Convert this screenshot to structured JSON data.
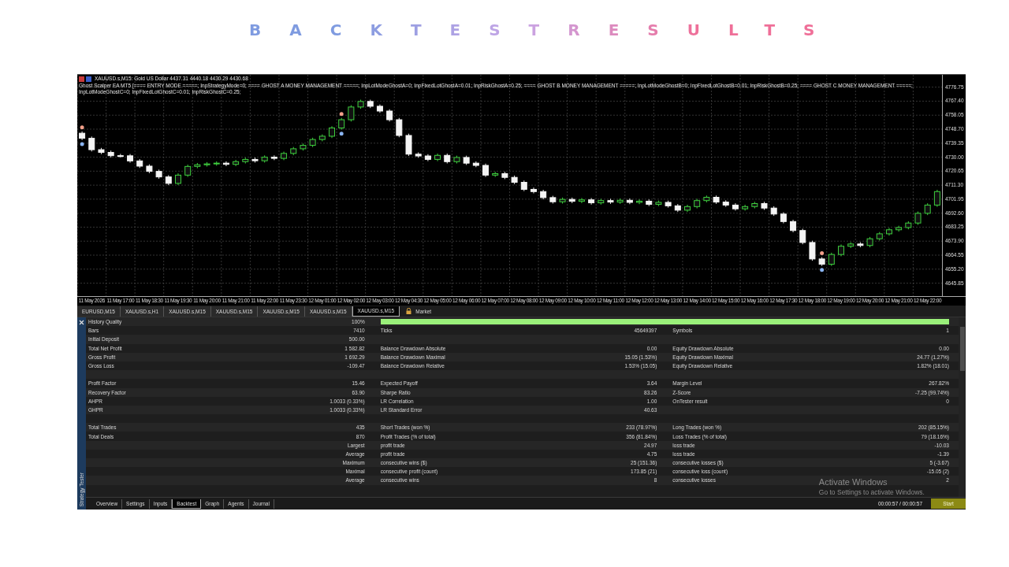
{
  "title": "BACKTESTRESULTS",
  "chart": {
    "symbol_line": "XAUUSD.s,M15:  Gold US Dollar  4437.31 4440.18 4430.29 4430.68",
    "ea_line": "Ghost Scalper EA MT5 [==== ENTRY MODE =====; InpStrategyMode=0; ==== GHOST A MONEY MANAGEMENT =====; InpLotModeGhostA=0; InpFixedLotGhostA=0.01; InpRiskGhostA=0.25; ==== GHOST B MONEY MANAGEMENT =====; InpLotModeGhostB=0; InpFixedLotGhostB=0.01; InpRiskGhostB=0.25; ==== GHOST C MONEY MANAGEMENT =====; InpLotModeGhostC=0; InpFixedLotGhostC=0.01; InpRiskGhostC=0.25;",
    "chart_data": {
      "type": "candlestick",
      "categories": [
        null,
        "11 May 2026",
        null,
        null,
        "11 May 17:00",
        null,
        null,
        "11 May 18:30",
        null,
        null,
        "11 May 19:30",
        null,
        null,
        "11 May 20:00",
        null,
        null,
        "11 May 21:00",
        null,
        null,
        "11 May 22:00",
        null,
        null,
        "11 May 23:30",
        null,
        null,
        "12 May 01:00",
        null,
        null,
        "12 May 02:00",
        null,
        null,
        "12 May 03:00",
        null,
        null,
        "12 May 04:30",
        null,
        null,
        "12 May 05:00",
        null,
        null,
        "12 May 06:00",
        null,
        null,
        "12 May 07:00",
        null,
        null,
        "12 May 08:00",
        null,
        null,
        "12 May 09:00",
        null,
        null,
        "12 May 10:00",
        null,
        null,
        "12 May 11:00",
        null,
        null,
        "12 May 12:00",
        null,
        null,
        "12 May 13:00",
        null,
        null,
        "12 May 14:00",
        null,
        null,
        "12 May 15:00",
        null,
        null,
        "12 May 16:00",
        null,
        null,
        "12 May 17:30",
        null,
        null,
        "12 May 18:00",
        null,
        null,
        "12 May 19:00",
        null,
        null,
        "12 May 20:00",
        null,
        null,
        "12 May 21:00",
        null,
        null,
        "12 May 22:00",
        null
      ],
      "grid": true,
      "ohlc": [
        [
          4746.0,
          4747.2,
          4741.4,
          4742.6
        ],
        [
          4742.6,
          4743.8,
          4733.8,
          4735.0
        ],
        [
          4735.0,
          4736.2,
          4732.0,
          4733.2
        ],
        [
          4733.2,
          4734.4,
          4729.8,
          4731.0
        ],
        [
          4731.0,
          4732.2,
          4729.7,
          4730.9
        ],
        [
          4730.9,
          4732.1,
          4726.3,
          4727.5
        ],
        [
          4727.5,
          4728.7,
          4722.8,
          4724.0
        ],
        [
          4724.0,
          4725.2,
          4719.3,
          4720.5
        ],
        [
          4720.5,
          4721.7,
          4715.6,
          4716.8
        ],
        [
          4716.8,
          4718.0,
          4711.3,
          4712.5
        ],
        [
          4712.5,
          4719.2,
          4711.3,
          4718.0
        ],
        [
          4718.0,
          4725.0,
          4716.8,
          4723.8
        ],
        [
          4723.8,
          4726.1,
          4722.6,
          4724.9
        ],
        [
          4724.9,
          4726.7,
          4723.7,
          4725.5
        ],
        [
          4725.5,
          4727.2,
          4724.3,
          4726.0
        ],
        [
          4726.0,
          4727.2,
          4724.0,
          4725.2
        ],
        [
          4725.2,
          4728.2,
          4724.0,
          4727.0
        ],
        [
          4727.0,
          4729.7,
          4725.8,
          4728.5
        ],
        [
          4728.5,
          4729.7,
          4726.4,
          4727.6
        ],
        [
          4727.6,
          4731.2,
          4726.4,
          4730.0
        ],
        [
          4730.0,
          4731.2,
          4728.0,
          4729.2
        ],
        [
          4729.2,
          4733.7,
          4728.0,
          4732.5
        ],
        [
          4732.5,
          4736.8,
          4731.3,
          4735.6
        ],
        [
          4735.6,
          4739.1,
          4734.4,
          4737.9
        ],
        [
          4737.9,
          4743.0,
          4736.7,
          4741.8
        ],
        [
          4741.8,
          4745.2,
          4740.6,
          4744.0
        ],
        [
          4744.0,
          4750.7,
          4742.8,
          4749.5
        ],
        [
          4749.5,
          4756.2,
          4748.3,
          4755.0
        ],
        [
          4755.0,
          4764.7,
          4753.8,
          4763.5
        ],
        [
          4763.5,
          4768.4,
          4762.3,
          4767.2
        ],
        [
          4767.2,
          4768.4,
          4762.8,
          4764.0
        ],
        [
          4764.0,
          4765.2,
          4759.6,
          4760.8
        ],
        [
          4760.8,
          4762.0,
          4753.8,
          4755.0
        ],
        [
          4755.0,
          4756.2,
          4743.3,
          4744.5
        ],
        [
          4744.5,
          4745.7,
          4730.8,
          4732.0
        ],
        [
          4732.0,
          4733.2,
          4729.6,
          4730.8
        ],
        [
          4730.8,
          4732.0,
          4727.3,
          4728.5
        ],
        [
          4728.5,
          4732.4,
          4727.3,
          4731.2
        ],
        [
          4731.2,
          4732.4,
          4725.8,
          4727.0
        ],
        [
          4727.0,
          4731.0,
          4725.8,
          4729.8
        ],
        [
          4729.8,
          4731.0,
          4724.8,
          4726.0
        ],
        [
          4726.0,
          4727.2,
          4723.3,
          4724.5
        ],
        [
          4724.5,
          4725.7,
          4716.8,
          4718.0
        ],
        [
          4718.0,
          4720.2,
          4716.8,
          4719.0
        ],
        [
          4719.0,
          4720.2,
          4715.3,
          4716.5
        ],
        [
          4716.5,
          4717.7,
          4712.0,
          4713.2
        ],
        [
          4713.2,
          4714.4,
          4707.3,
          4708.5
        ],
        [
          4708.5,
          4709.7,
          4705.8,
          4707.0
        ],
        [
          4707.0,
          4708.2,
          4701.8,
          4703.0
        ],
        [
          4703.0,
          4704.2,
          4699.0,
          4700.2
        ],
        [
          4700.2,
          4703.0,
          4699.0,
          4701.8
        ],
        [
          4701.8,
          4703.0,
          4699.3,
          4700.5
        ],
        [
          4700.5,
          4702.7,
          4699.3,
          4701.5
        ],
        [
          4701.5,
          4702.7,
          4698.3,
          4699.5
        ],
        [
          4699.5,
          4702.2,
          4698.3,
          4701.0
        ],
        [
          4701.0,
          4702.2,
          4698.8,
          4700.0
        ],
        [
          4700.0,
          4702.4,
          4698.8,
          4701.2
        ],
        [
          4701.2,
          4702.4,
          4698.6,
          4699.8
        ],
        [
          4699.8,
          4701.8,
          4698.6,
          4700.6
        ],
        [
          4700.6,
          4701.8,
          4697.3,
          4698.5
        ],
        [
          4698.5,
          4701.0,
          4697.3,
          4699.8
        ],
        [
          4699.8,
          4701.0,
          4696.3,
          4697.5
        ],
        [
          4697.5,
          4698.7,
          4693.4,
          4694.6
        ],
        [
          4694.6,
          4698.2,
          4693.4,
          4697.0
        ],
        [
          4697.0,
          4702.2,
          4695.8,
          4701.0
        ],
        [
          4701.0,
          4704.4,
          4699.8,
          4703.2
        ],
        [
          4703.2,
          4704.4,
          4698.8,
          4700.0
        ],
        [
          4700.0,
          4701.2,
          4696.8,
          4698.0
        ],
        [
          4698.0,
          4699.2,
          4694.3,
          4695.5
        ],
        [
          4695.5,
          4698.2,
          4694.3,
          4697.0
        ],
        [
          4697.0,
          4700.2,
          4695.8,
          4699.0
        ],
        [
          4699.0,
          4700.2,
          4694.8,
          4696.0
        ],
        [
          4696.0,
          4697.2,
          4690.8,
          4692.0
        ],
        [
          4692.0,
          4693.2,
          4685.8,
          4687.0
        ],
        [
          4687.0,
          4688.2,
          4679.8,
          4681.0
        ],
        [
          4681.0,
          4682.2,
          4671.8,
          4673.0
        ],
        [
          4673.0,
          4674.2,
          4660.8,
          4662.0
        ],
        [
          4662.0,
          4663.2,
          4657.3,
          4658.5
        ],
        [
          4658.5,
          4666.2,
          4657.3,
          4665.0
        ],
        [
          4665.0,
          4671.7,
          4663.8,
          4670.5
        ],
        [
          4670.5,
          4673.2,
          4669.3,
          4672.0
        ],
        [
          4672.0,
          4673.2,
          4669.8,
          4671.0
        ],
        [
          4671.0,
          4676.7,
          4669.8,
          4675.5
        ],
        [
          4675.5,
          4680.0,
          4674.3,
          4678.8
        ],
        [
          4678.8,
          4682.7,
          4677.6,
          4681.5
        ],
        [
          4681.5,
          4684.2,
          4680.3,
          4683.0
        ],
        [
          4683.0,
          4687.2,
          4681.8,
          4686.0
        ],
        [
          4686.0,
          4693.7,
          4684.8,
          4692.5
        ],
        [
          4692.5,
          4699.2,
          4691.3,
          4698.0
        ],
        [
          4698.0,
          4708.2,
          4696.8,
          4707.0
        ]
      ],
      "ylim": [
        4637.2,
        4785
      ],
      "yticks": [
        {
          "value": 4776.75,
          "label": "4776.75"
        },
        {
          "value": 4767.4,
          "label": "4767.40"
        },
        {
          "value": 4758.05,
          "label": "4758.05"
        },
        {
          "value": 4748.7,
          "label": "4748.70"
        },
        {
          "value": 4739.35,
          "label": "4739.35"
        },
        {
          "value": 4730,
          "label": "4730.00"
        },
        {
          "value": 4720.65,
          "label": "4720.65"
        },
        {
          "value": 4711.3,
          "label": "4711.30"
        },
        {
          "value": 4701.95,
          "label": "4701.95"
        },
        {
          "value": 4692.6,
          "label": "4692.60"
        },
        {
          "value": 4683.25,
          "label": "4683.25"
        },
        {
          "value": 4673.9,
          "label": "4673.90"
        },
        {
          "value": 4664.55,
          "label": "4664.55"
        },
        {
          "value": 4655.2,
          "label": "4655.20"
        },
        {
          "value": 4645.85,
          "label": "4645.85"
        }
      ]
    }
  },
  "symbol_tabs": [
    {
      "label": "EURUSD,M15",
      "selected": false
    },
    {
      "label": "XAUUSD.s,H1",
      "selected": false
    },
    {
      "label": "XAUUSD.s,M15",
      "selected": false
    },
    {
      "label": "XAUUSD.s,M15",
      "selected": false
    },
    {
      "label": "XAUUSD.s,M15",
      "selected": false
    },
    {
      "label": "XAUUSD.s,M15",
      "selected": false
    },
    {
      "label": "XAUUSD.s,M15",
      "selected": true
    }
  ],
  "market_tab": "Market",
  "tester": {
    "side_label": "Strategy Tester",
    "rows": [
      {
        "kind": "quality",
        "groups": [
          {
            "label": "History Quality",
            "value": "100%"
          }
        ],
        "level": 1
      },
      {
        "kind": "stats",
        "groups": [
          {
            "label": "Bars",
            "value": "7410"
          },
          {
            "label": "Ticks",
            "value": "45649397"
          },
          {
            "label": "Symbols",
            "value": "1"
          }
        ]
      },
      {
        "kind": "stats",
        "groups": [
          {
            "label": "Initial Deposit",
            "value": "500.00"
          }
        ]
      },
      {
        "kind": "stats",
        "groups": [
          {
            "label": "Total Net Profit",
            "value": "1 582.82"
          },
          {
            "label": "Balance Drawdown Absolute",
            "value": "0.00"
          },
          {
            "label": "Equity Drawdown Absolute",
            "value": "0.00"
          }
        ]
      },
      {
        "kind": "stats",
        "groups": [
          {
            "label": "Gross Profit",
            "value": "1 692.29"
          },
          {
            "label": "Balance Drawdown Maximal",
            "value": "15.05 (1.53%)"
          },
          {
            "label": "Equity Drawdown Maximal",
            "value": "24.77 (1.27%)"
          }
        ]
      },
      {
        "kind": "stats",
        "groups": [
          {
            "label": "Gross Loss",
            "value": "-109.47"
          },
          {
            "label": "Balance Drawdown Relative",
            "value": "1.53% (15.05)"
          },
          {
            "label": "Equity Drawdown Relative",
            "value": "1.82% (18.01)"
          }
        ]
      },
      {
        "kind": "blank"
      },
      {
        "kind": "stats",
        "groups": [
          {
            "label": "Profit Factor",
            "value": "15.46"
          },
          {
            "label": "Expected Payoff",
            "value": "3.64"
          },
          {
            "label": "Margin Level",
            "value": "267.82%"
          }
        ]
      },
      {
        "kind": "stats",
        "groups": [
          {
            "label": "Recovery Factor",
            "value": "63.90"
          },
          {
            "label": "Sharpe Ratio",
            "value": "83.26"
          },
          {
            "label": "Z-Score",
            "value": "-7.25 (99.74%)"
          }
        ]
      },
      {
        "kind": "stats",
        "groups": [
          {
            "label": "AHPR",
            "value": "1.0033 (0.33%)"
          },
          {
            "label": "LR Correlation",
            "value": "1.00"
          },
          {
            "label": "OnTester result",
            "value": "0"
          }
        ]
      },
      {
        "kind": "stats",
        "groups": [
          {
            "label": "GHPR",
            "value": "1.0033 (0.33%)"
          },
          {
            "label": "LR Standard Error",
            "value": "40.63"
          }
        ]
      },
      {
        "kind": "blank"
      },
      {
        "kind": "stats",
        "groups": [
          {
            "label": "Total Trades",
            "value": "435"
          },
          {
            "label": "Short Trades (won %)",
            "value": "233 (78.97%)"
          },
          {
            "label": "Long Trades (won %)",
            "value": "202 (85.15%)"
          }
        ]
      },
      {
        "kind": "stats",
        "groups": [
          {
            "label": "Total Deals",
            "value": "870"
          },
          {
            "label": "Profit Trades (% of total)",
            "value": "356 (81.84%)"
          },
          {
            "label": "Loss Trades (% of total)",
            "value": "79 (18.16%)"
          }
        ]
      },
      {
        "kind": "stats",
        "groups": [
          {
            "value": "Largest"
          },
          {
            "label": "profit trade",
            "value": "24.97"
          },
          {
            "label": "loss trade",
            "value": "-10.03"
          }
        ]
      },
      {
        "kind": "stats",
        "groups": [
          {
            "value": "Average"
          },
          {
            "label": "profit trade",
            "value": "4.75"
          },
          {
            "label": "loss trade",
            "value": "-1.39"
          }
        ]
      },
      {
        "kind": "stats",
        "groups": [
          {
            "value": "Maximum"
          },
          {
            "label": "consecutive wins ($)",
            "value": "25 (151.36)"
          },
          {
            "label": "consecutive losses ($)",
            "value": "5 (-3.67)"
          }
        ]
      },
      {
        "kind": "stats",
        "groups": [
          {
            "value": "Maximal"
          },
          {
            "label": "consecutive profit (count)",
            "value": "173.85 (21)"
          },
          {
            "label": "consecutive loss (count)",
            "value": "-15.05 (2)"
          }
        ]
      },
      {
        "kind": "stats",
        "groups": [
          {
            "value": "Average"
          },
          {
            "label": "consecutive wins",
            "value": "8"
          },
          {
            "label": "consecutive losses",
            "value": "2"
          }
        ]
      },
      {
        "kind": "blank"
      }
    ],
    "tabs": [
      {
        "label": "Overview",
        "selected": false
      },
      {
        "label": "Settings",
        "selected": false
      },
      {
        "label": "Inputs",
        "selected": false
      },
      {
        "label": "Backtest",
        "selected": true
      },
      {
        "label": "Graph",
        "selected": false
      },
      {
        "label": "Agents",
        "selected": false
      },
      {
        "label": "Journal",
        "selected": false
      }
    ],
    "elapsed": "00:00:57 / 00:00:57",
    "start_button": "Start"
  },
  "activation_notice": {
    "title": "Activate Windows",
    "hint": "Go to Settings to activate Windows."
  }
}
